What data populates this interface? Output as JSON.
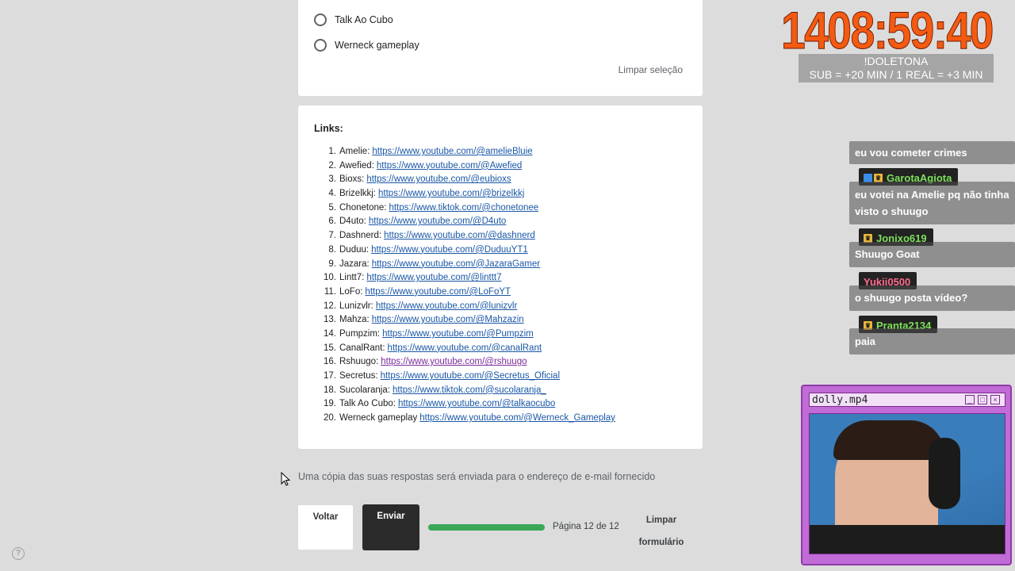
{
  "options": {
    "items": [
      "Talk Ao Cubo",
      "Werneck gameplay"
    ],
    "clear_selection": "Limpar seleção"
  },
  "links": {
    "title": "Links:",
    "items": [
      {
        "num": "1.",
        "name": "Amelie:",
        "url": "https://www.youtube.com/@amelieBluie"
      },
      {
        "num": "2.",
        "name": "Awefied:",
        "url": "https://www.youtube.com/@Awefied"
      },
      {
        "num": "3.",
        "name": "Bioxs:",
        "url": "https://www.youtube.com/@eubioxs"
      },
      {
        "num": "4.",
        "name": "Brizelkkj:",
        "url": "https://www.youtube.com/@brizelkkj"
      },
      {
        "num": "5.",
        "name": "Chonetone:",
        "url": "https://www.tiktok.com/@chonetonee"
      },
      {
        "num": "6.",
        "name": "D4uto:",
        "url": "https://www.youtube.com/@D4uto"
      },
      {
        "num": "7.",
        "name": "Dashnerd:",
        "url": "https://www.youtube.com/@dashnerd"
      },
      {
        "num": "8.",
        "name": "Duduu:",
        "url": "https://www.youtube.com/@DuduuYT1"
      },
      {
        "num": "9.",
        "name": "Jazara:",
        "url": "https://www.youtube.com/@JazaraGamer"
      },
      {
        "num": "10.",
        "name": "Lintt7:",
        "url": "https://www.youtube.com/@linttt7"
      },
      {
        "num": "11.",
        "name": "LoFo:",
        "url": "https://www.youtube.com/@LoFoYT"
      },
      {
        "num": "12.",
        "name": "Lunizvlr:",
        "url": "https://www.youtube.com/@lunizvlr"
      },
      {
        "num": "13.",
        "name": "Mahza:",
        "url": "https://www.youtube.com/@Mahzazin"
      },
      {
        "num": "14.",
        "name": "Pumpzim:",
        "url": "https://www.youtube.com/@Pumpzim"
      },
      {
        "num": "15.",
        "name": "CanalRant:",
        "url": "https://www.youtube.com/@canalRant"
      },
      {
        "num": "16.",
        "name": "Rshuugo:",
        "url": "https://www.youtube.com/@rshuugo"
      },
      {
        "num": "17.",
        "name": "Secretus:",
        "url": "https://www.youtube.com/@Secretus_Oficial"
      },
      {
        "num": "18.",
        "name": "Sucolaranja:",
        "url": "https://www.tiktok.com/@sucolaranja_"
      },
      {
        "num": "19.",
        "name": "Talk Ao Cubo:",
        "url": "https://www.youtube.com/@talkaocubo"
      },
      {
        "num": "20.",
        "name": "Werneck gameplay",
        "url": "https://www.youtube.com/@Werneck_Gameplay"
      }
    ]
  },
  "form": {
    "copy_note": "Uma cópia das suas respostas será enviada para o endereço de e-mail fornecido",
    "back_label": "Voltar",
    "send_label": "Enviar",
    "progress": 1.0,
    "page_label": "Página 12 de 12",
    "clear_form_label": "Limpar formulário",
    "progress_color": "#3aa757"
  },
  "overlay": {
    "timer": "1408:59:40",
    "sub_line1": "!DOLETONA",
    "sub_line2": "SUB = +20  MIN / 1 REAL = +3 MIN",
    "chat": [
      {
        "name": "",
        "text": "eu vou cometer crimes"
      },
      {
        "name": "GarotaAgiota",
        "name_color": "#7de05a",
        "text": "eu votei na Amelie pq não tinha visto o shuugo"
      },
      {
        "name": "Jonixo619",
        "name_color": "#7de05a",
        "text": "Shuugo Goat"
      },
      {
        "name": "Yukii0500",
        "name_color": "#ff6b8f",
        "text": "o shuugo posta vídeo?"
      },
      {
        "name": "Pranta2134",
        "name_color": "#7de05a",
        "text": "paia"
      }
    ],
    "player_title": "dolly.mp4"
  }
}
